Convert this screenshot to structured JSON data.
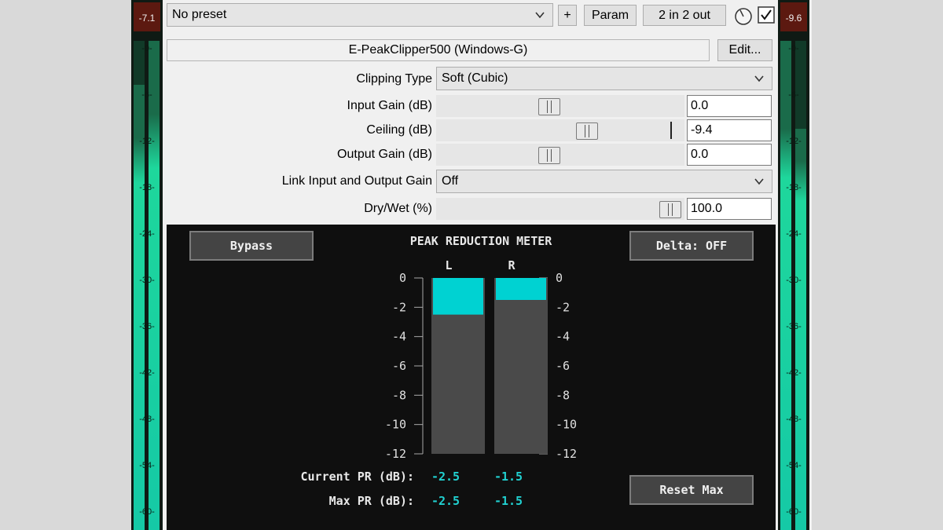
{
  "meters": {
    "left": {
      "peak": "-7.1",
      "ticks": [
        "-0-",
        "-6-",
        "-12-",
        "-18-",
        "-24-",
        "-30-",
        "-36-",
        "-42-",
        "-48-",
        "-54-",
        "-60-"
      ]
    },
    "right": {
      "peak": "-9.6",
      "ticks": [
        "-0-",
        "-6-",
        "-12-",
        "-18-",
        "-24-",
        "-30-",
        "-36-",
        "-42-",
        "-48-",
        "-54-",
        "-60-"
      ]
    }
  },
  "toolbar": {
    "preset": "No preset",
    "plus": "+",
    "param": "Param",
    "io": "2 in 2 out"
  },
  "plugin_name": "E-PeakClipper500 (Windows-G)",
  "edit_label": "Edit...",
  "params": {
    "clipping_type": {
      "label": "Clipping Type",
      "value": "Soft (Cubic)"
    },
    "input_gain": {
      "label": "Input Gain (dB)",
      "value": "0.0",
      "pos": 0.45
    },
    "ceiling": {
      "label": "Ceiling (dB)",
      "value": "-9.4",
      "pos": 0.62
    },
    "output_gain": {
      "label": "Output Gain (dB)",
      "value": "0.0",
      "pos": 0.45
    },
    "link": {
      "label": "Link Input and Output Gain",
      "value": "Off"
    },
    "drywet": {
      "label": "Dry/Wet (%)",
      "value": "100.0",
      "pos": 1.0
    }
  },
  "panel": {
    "bypass": "Bypass",
    "title": "PEAK REDUCTION METER",
    "delta": "Delta: OFF",
    "ch_l": "L",
    "ch_r": "R",
    "scale": [
      "0",
      "-2",
      "-4",
      "-6",
      "-8",
      "-10",
      "-12"
    ],
    "current_label": "Current PR (dB):",
    "max_label": "Max PR (dB):",
    "current_l": "-2.5",
    "current_r": "-1.5",
    "max_l": "-2.5",
    "max_r": "-1.5",
    "reset": "Reset Max"
  },
  "colors": {
    "accent": "#21d0d0",
    "meter_fill": "#18d9a2"
  }
}
